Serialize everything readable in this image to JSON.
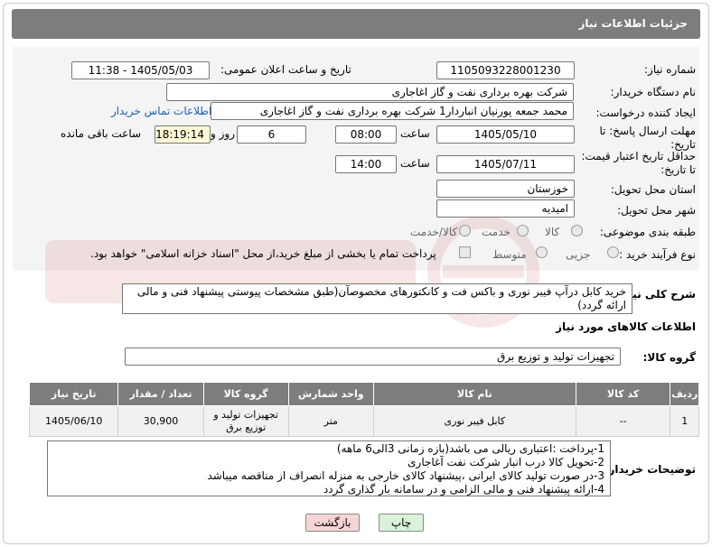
{
  "page_title": "جزئیات اطلاعات نیاز",
  "labels": {
    "need_number": "شماره نیاز:",
    "announce_datetime": "تاریخ و ساعت اعلان عمومی:",
    "buyer_org": "نام دستگاه خریدار:",
    "requester": "ایجاد کننده درخواست:",
    "send_deadline": "مهلت ارسال پاسخ: تا تاریخ:",
    "price_validity": "حداقل تاریخ اعتبار قیمت: تا تاریخ:",
    "time": "ساعت",
    "day_and": "روز و",
    "remaining": "ساعت باقی مانده",
    "province": "استان محل تحویل:",
    "city": "شهر محل تحویل:",
    "category": "طبقه بندی موضوعی:",
    "process_type": "نوع فرآیند خرید :",
    "general_desc": "شرح کلی نیاز:",
    "goods_info": "اطلاعات کالاهای مورد نیاز",
    "goods_group": "گروه کالا:",
    "buyer_notes": "توضیحات خریدار:"
  },
  "fields": {
    "need_number": "1105093228001230",
    "announce_datetime": "1405/05/03 - 11:38",
    "buyer_org": "شرکت بهره برداری نفت و گاز اغاجاری",
    "requester": "محمد جمعه پورنیان انباردار1 شرکت بهره برداری نفت و گاز اغاجاری",
    "contact_link": "اطلاعات تماس خریدار",
    "send_date": "1405/05/10",
    "send_time": "08:00",
    "days": "6",
    "remaining_time": "18:19:14",
    "validity_date": "1405/07/11",
    "validity_time": "14:00",
    "province": "خوزستان",
    "city": "امیدیه",
    "goods_group": "تجهیزات تولید و توزیع برق"
  },
  "category_options": [
    "کالا",
    "خدمت",
    "کالا/خدمت"
  ],
  "process_options": [
    "جزیی",
    "متوسط"
  ],
  "payment_note": "پرداخت تمام یا بخشی از مبلغ خرید،از محل \"اسناد خزانه اسلامی\" خواهد بود.",
  "general_description": "خرید کابل درآپ فیبر نوری و باکس فت و کانکتورهای مخصوصآن(طبق مشخصات پیوستی پیشنهاد فنی و مالی ارائه گردد)",
  "table": {
    "headers": [
      "ردیف",
      "کد کالا",
      "نام کالا",
      "واحد شمارش",
      "گروه کالا",
      "تعداد / مقدار",
      "تاریخ نیاز"
    ],
    "rows": [
      [
        "1",
        "--",
        "کابل فیبر نوری",
        "متر",
        "تجهیزات تولید و توزیع برق",
        "30,900",
        "1405/06/10"
      ]
    ]
  },
  "notes": [
    "1-پرداخت :اعتباری ریالی می باشد(بازه زمانی 3الی6 ماهه)",
    "2-تحویل کالا درب انبار شرکت نفت آغاجاری",
    "3-در صورت تولید کالای ایرانی ،پیشنهاد کالای خارجی به منزله انصراف از مناقصه میباشد",
    "4-ارائه پیشنهاد فنی و مالی الزامی و در سامانه بار گذاری گردد"
  ],
  "buttons": {
    "print": "چاپ",
    "back": "بازگشت"
  },
  "colors": {
    "header": "#7d7d7d",
    "link": "#1f5fb4",
    "print_btn": "#d9f2d9",
    "back_btn": "#f6d5d5"
  }
}
